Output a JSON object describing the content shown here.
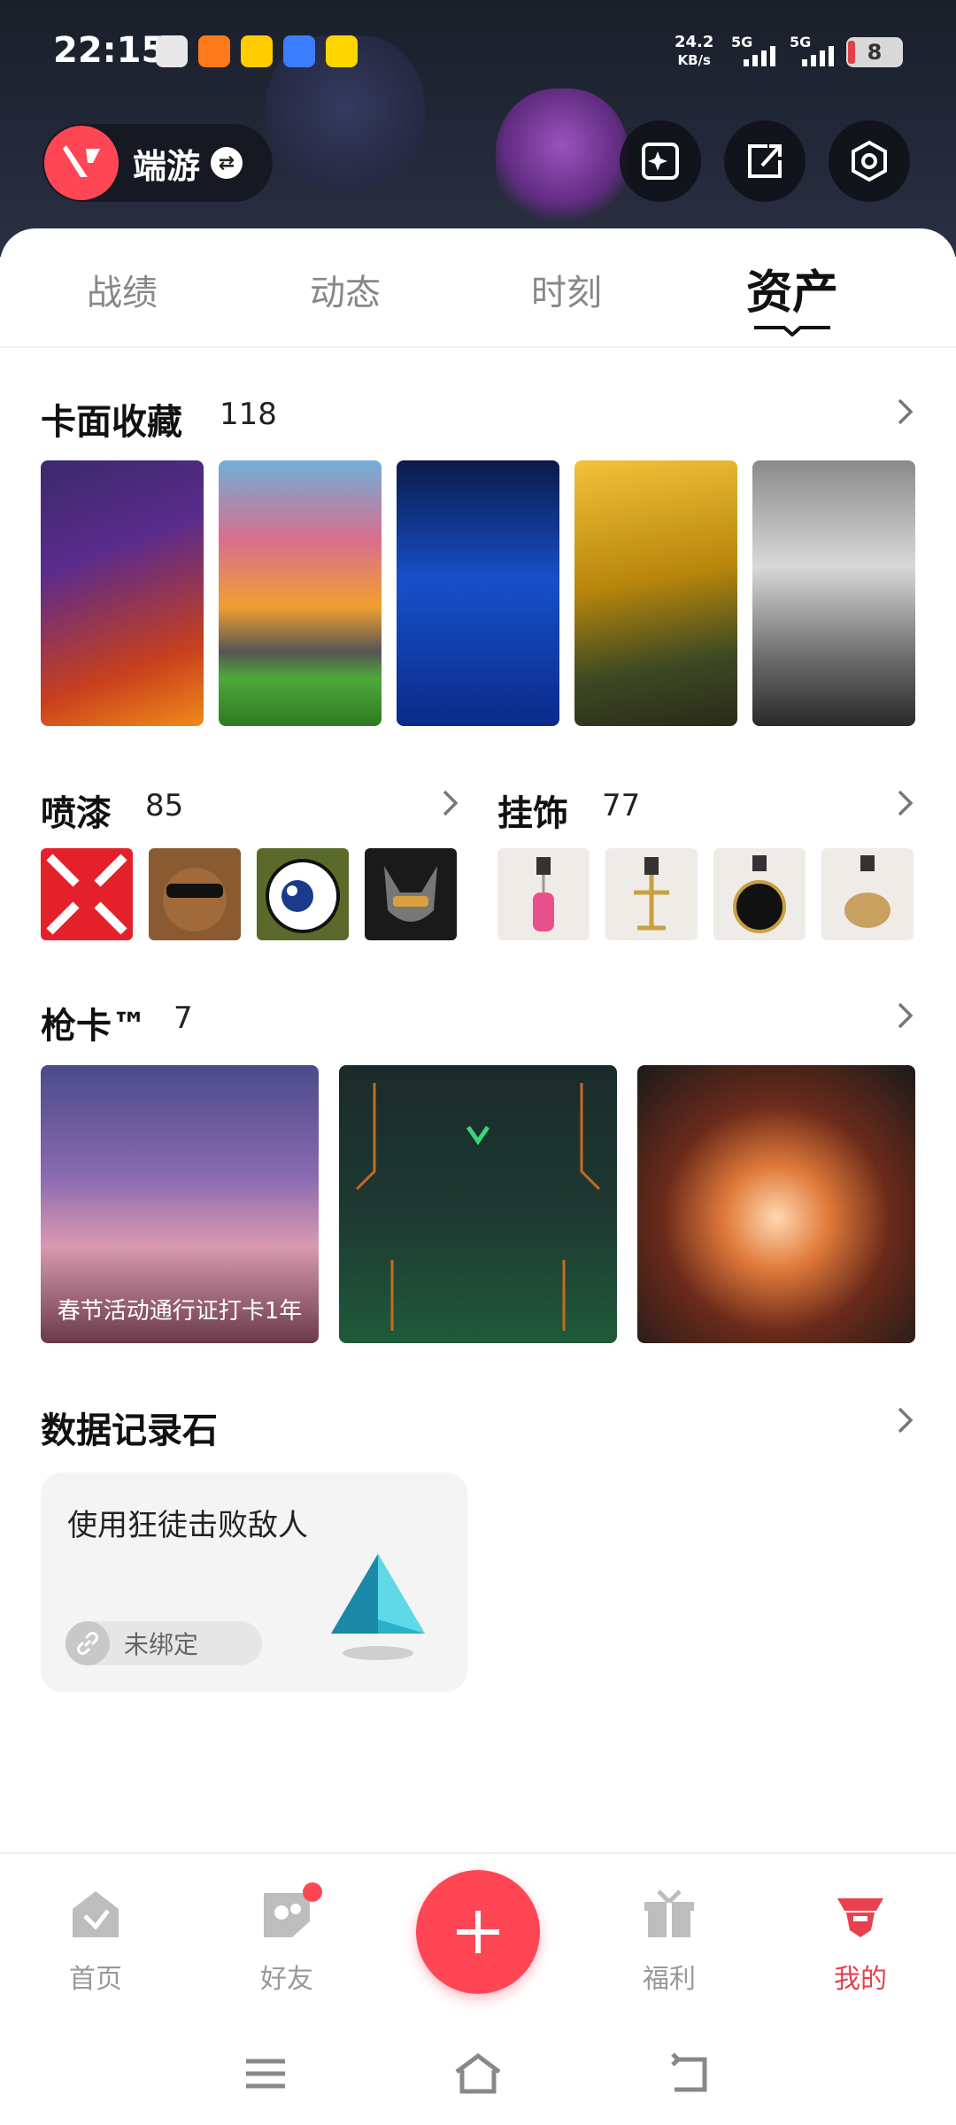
{
  "status_bar": {
    "time": "22:15",
    "net_speed": "24.2",
    "net_unit": "KB/s",
    "signal1": "5G",
    "signal2": "5G",
    "battery": "8"
  },
  "header": {
    "game_name": "端游",
    "buttons": [
      "ai-sparkle-icon",
      "share-icon",
      "settings-hex-icon"
    ]
  },
  "tabs": [
    {
      "label": "战绩",
      "active": false
    },
    {
      "label": "动态",
      "active": false
    },
    {
      "label": "时刻",
      "active": false
    },
    {
      "label": "资产",
      "active": true
    }
  ],
  "card_collection": {
    "title": "卡面收藏",
    "count": "118"
  },
  "sprays": {
    "title": "喷漆",
    "count": "85"
  },
  "charms": {
    "title": "挂饰",
    "count": "77"
  },
  "gun_cards": {
    "title": "枪卡™",
    "count": "7",
    "items": [
      {
        "caption": "春节活动通行证打卡1年"
      },
      {
        "caption": ""
      },
      {
        "caption": ""
      }
    ]
  },
  "data_stones": {
    "title": "数据记录石",
    "item_text": "使用狂徒击败敌人",
    "status": "未绑定"
  },
  "bottom_nav": [
    {
      "label": "首页",
      "icon": "home-icon"
    },
    {
      "label": "好友",
      "icon": "friends-icon"
    },
    {
      "label": "福利",
      "icon": "gift-icon"
    },
    {
      "label": "我的",
      "icon": "profile-icon",
      "active": true
    }
  ],
  "colors": {
    "accent": "#ff4655",
    "active_nav": "#e8404c"
  }
}
